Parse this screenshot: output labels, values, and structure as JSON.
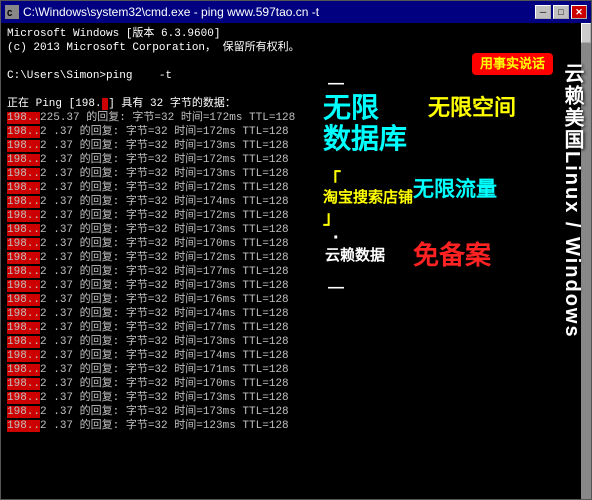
{
  "window": {
    "title": "C:\\Windows\\system32\\cmd.exe - ping  www.597tao.cn -t",
    "icon": "CMD"
  },
  "titlebar": {
    "minimize_label": "─",
    "maximize_label": "□",
    "close_label": "✕"
  },
  "cmd": {
    "line1": "Microsoft Windows [版本 6.3.9600]",
    "line2": "(c) 2013 Microsoft Corporation. 保留所有权利。",
    "line3": "",
    "line4": "C:\\Users\\Simon>ping              -t",
    "ping_header": "正在 Ping              [198.        ] 具有 32 字节的数据："
  },
  "badge": {
    "text": "用事实说话"
  },
  "overlay": {
    "line1": "—",
    "line2": "无限",
    "line3": "数据库",
    "line4": "「",
    "line5": "淘宝搜索店铺",
    "line6": "」",
    "line7": "·",
    "line8": "云赖数据",
    "line9": "—",
    "unlimited_space": "无限空间",
    "unlimited_traffic": "无限流量",
    "free_backup": "免备案",
    "right_text": "云赖美国Linux / Windows"
  }
}
